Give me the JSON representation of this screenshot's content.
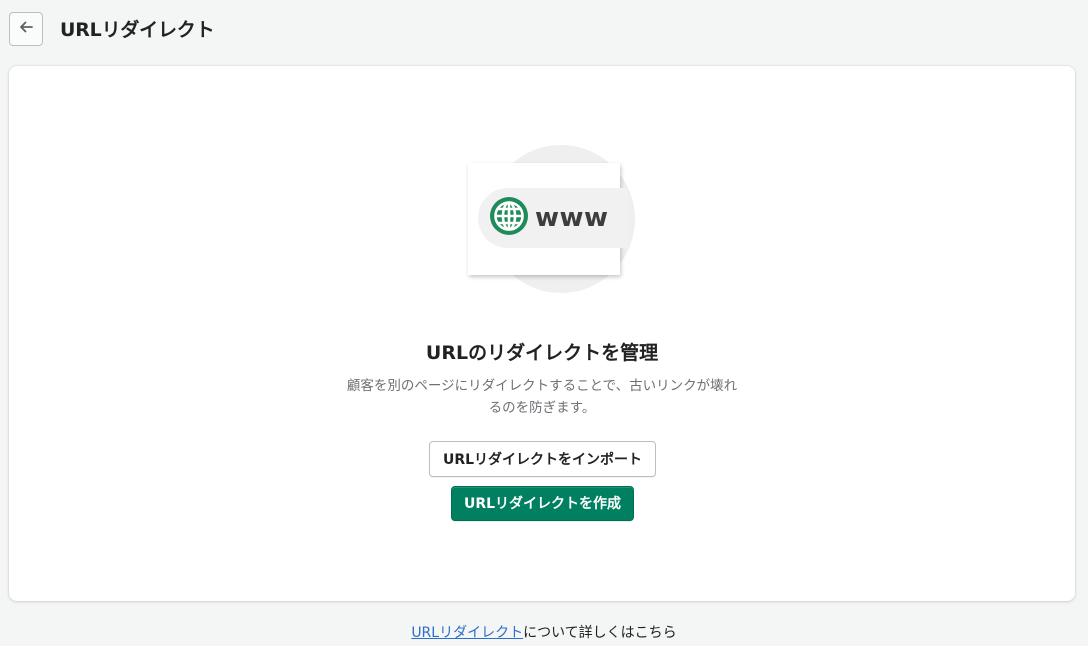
{
  "header": {
    "title": "URLリダイレクト",
    "back_icon": "arrow-left-icon"
  },
  "empty_state": {
    "illustration_text": "www",
    "illustration_icon": "globe-icon",
    "heading": "URLのリダイレクトを管理",
    "description": "顧客を別のページにリダイレクトすることで、古いリンクが壊れるのを防ぎます。",
    "import_label": "URLリダイレクトをインポート",
    "create_label": "URLリダイレクトを作成"
  },
  "footer": {
    "link_text": "URLリダイレクト",
    "suffix_text": "について詳しくはこちら"
  },
  "colors": {
    "accent": "#008060",
    "link": "#2c6ecb",
    "globe": "#1f8a5a"
  }
}
